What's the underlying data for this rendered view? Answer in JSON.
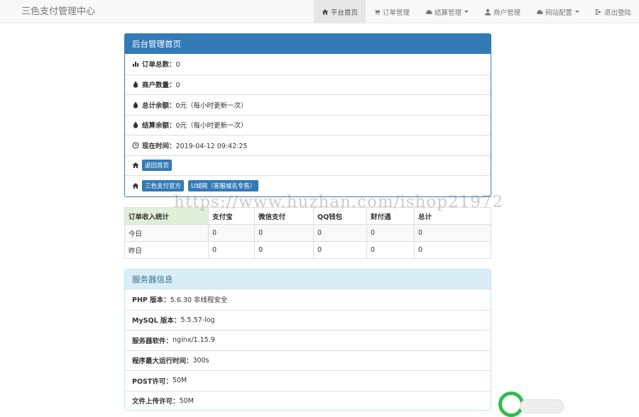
{
  "brand": "三色支付管理中心",
  "nav": [
    {
      "label": "平台首页",
      "icon": "home-icon"
    },
    {
      "label": "订单管理",
      "icon": "cart-icon"
    },
    {
      "label": "结算管理",
      "icon": "cloud-icon"
    },
    {
      "label": "商户管理",
      "icon": "user-icon"
    },
    {
      "label": "网站配置",
      "icon": "cloud-icon"
    },
    {
      "label": "退出登陆",
      "icon": "logout-icon"
    }
  ],
  "admin_panel": {
    "title": "后台管理首页",
    "order_total": {
      "label": "订单总数：",
      "value": "0"
    },
    "merchant_count": {
      "label": "商户数量：",
      "value": "0"
    },
    "total_balance": {
      "label": "总计余额：",
      "value": "0元（每小时更新一次）"
    },
    "settle_balance": {
      "label": "结算余额：",
      "value": "0元（每小时更新一次）"
    },
    "current_time": {
      "label": "现在时间：",
      "value": "2019-04-12 09:42:25"
    },
    "return_home": "返回首页",
    "official_link": "三色支付官方",
    "domain_link": "U城网（客服域名专售）"
  },
  "stats": {
    "headers": [
      "订单收入统计",
      "支付宝",
      "微信支付",
      "QQ钱包",
      "财付通",
      "总计"
    ],
    "rows": [
      [
        "今日",
        "0",
        "0",
        "0",
        "0",
        "0"
      ],
      [
        "昨日",
        "0",
        "0",
        "0",
        "0",
        "0"
      ]
    ]
  },
  "server_panel": {
    "title": "服务器信息",
    "items": [
      {
        "label": "PHP 版本：",
        "value": "5.6.30 非线程安全"
      },
      {
        "label": "MySQL 版本：",
        "value": "5.5.57-log"
      },
      {
        "label": "服务器软件：",
        "value": "nginx/1.15.9"
      },
      {
        "label": "程序最大运行时间：",
        "value": "300s"
      },
      {
        "label": "POST许可：",
        "value": "50M"
      },
      {
        "label": "文件上传许可：",
        "value": "50M"
      }
    ]
  },
  "watermark": "https://www.huzhan.com/ishop21972"
}
